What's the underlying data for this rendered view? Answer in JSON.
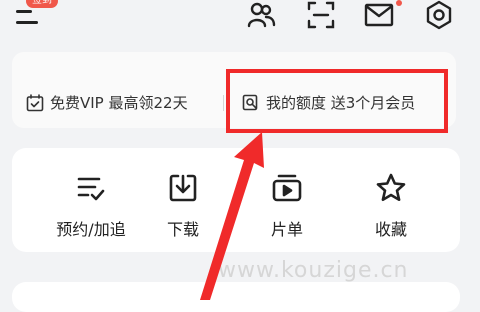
{
  "header": {
    "menu_badge": "签到",
    "icons": [
      "menu-icon",
      "friends-icon",
      "scan-icon",
      "mail-icon",
      "settings-icon"
    ]
  },
  "vip_banner": {
    "free_vip": {
      "icon": "calendar-check-icon",
      "label": "免费VIP 最高领22天"
    },
    "my_quota": {
      "icon": "quota-search-icon",
      "label": "我的额度 送3个月会员"
    }
  },
  "actions": [
    {
      "icon": "list-check-icon",
      "label": "预约/加追"
    },
    {
      "icon": "download-icon",
      "label": "下载"
    },
    {
      "icon": "playlist-icon",
      "label": "片单"
    },
    {
      "icon": "star-icon",
      "label": "收藏"
    }
  ],
  "watermark": "www.kouzige.cn",
  "colors": {
    "highlight": "#f02a2a",
    "badge": "#f0574a",
    "background": "#f2f3f5"
  }
}
